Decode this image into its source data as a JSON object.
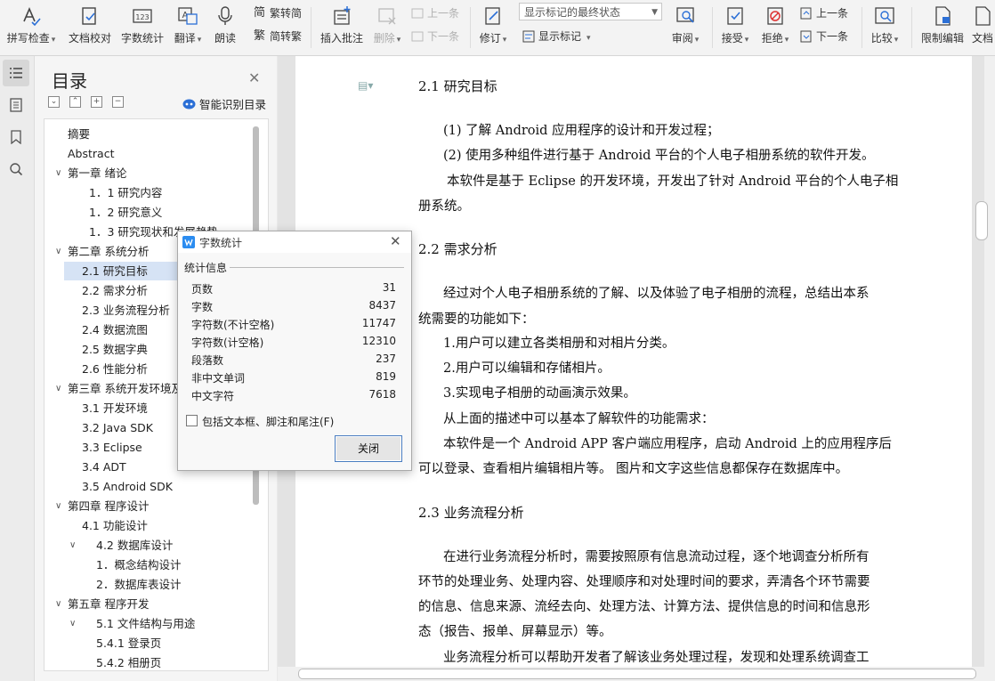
{
  "toolbar": {
    "items": [
      {
        "label": "拼写检查",
        "icon": "spellcheck-icon"
      },
      {
        "label": "文档校对",
        "icon": "proofread-icon"
      },
      {
        "label": "字数统计",
        "icon": "word-count-icon"
      },
      {
        "label": "翻译",
        "icon": "translate-icon"
      },
      {
        "label": "朗读",
        "icon": "read-aloud-icon"
      },
      {
        "label": "繁转简",
        "icon": "traditional-to-simple-icon"
      },
      {
        "label": "简转繁",
        "icon": "simple-to-traditional-icon"
      },
      {
        "label": "插入批注",
        "icon": "insert-comment-icon"
      },
      {
        "label": "删除",
        "icon": "delete-comment-icon"
      },
      {
        "label": "上一条",
        "icon": "prev-comment-icon"
      },
      {
        "label": "下一条",
        "icon": "next-comment-icon"
      },
      {
        "label": "修订",
        "icon": "track-changes-icon"
      },
      {
        "label": "显示标记",
        "icon": "show-markup-icon"
      },
      {
        "label": "审阅",
        "icon": "review-icon"
      },
      {
        "label": "接受",
        "icon": "accept-icon"
      },
      {
        "label": "拒绝",
        "icon": "reject-icon"
      },
      {
        "label": "上一条",
        "icon": "prev-change-icon"
      },
      {
        "label": "下一条",
        "icon": "next-change-icon"
      },
      {
        "label": "比较",
        "icon": "compare-icon"
      },
      {
        "label": "限制编辑",
        "icon": "restrict-editing-icon"
      },
      {
        "label": "文档",
        "icon": "document-icon"
      }
    ],
    "markup_mode": "显示标记的最终状态"
  },
  "toc": {
    "title": "目录",
    "smart_label": "智能识别目录",
    "items": [
      {
        "text": "摘要",
        "indent": 0,
        "chevron": false
      },
      {
        "text": "Abstract",
        "indent": 0,
        "chevron": false
      },
      {
        "text": "第一章 绪论",
        "indent": 0,
        "chevron": true
      },
      {
        "text": "1．1  研究内容",
        "indent": 2,
        "chevron": false
      },
      {
        "text": "1．2  研究意义",
        "indent": 2,
        "chevron": false
      },
      {
        "text": "1．3 研究现状和发展趋势",
        "indent": 2,
        "chevron": false
      },
      {
        "text": "第二章   系统分析",
        "indent": 0,
        "chevron": true
      },
      {
        "text": "2.1  研究目标",
        "indent": 1,
        "chevron": false,
        "selected": true
      },
      {
        "text": "2.2  需求分析",
        "indent": 1,
        "chevron": false
      },
      {
        "text": "2.3 业务流程分析",
        "indent": 1,
        "chevron": false
      },
      {
        "text": "2.4 数据流图",
        "indent": 1,
        "chevron": false
      },
      {
        "text": "2.5 数据字典",
        "indent": 1,
        "chevron": false
      },
      {
        "text": "2.6 性能分析",
        "indent": 1,
        "chevron": false
      },
      {
        "text": "第三章  系统开发环境及",
        "indent": 0,
        "chevron": true
      },
      {
        "text": "3.1 开发环境",
        "indent": 1,
        "chevron": false
      },
      {
        "text": "3.2 Java SDK",
        "indent": 1,
        "chevron": false
      },
      {
        "text": "3.3 Eclipse",
        "indent": 1,
        "chevron": false
      },
      {
        "text": "3.4 ADT",
        "indent": 1,
        "chevron": false
      },
      {
        "text": "3.5 Android SDK",
        "indent": 1,
        "chevron": false
      },
      {
        "text": "第四章  程序设计",
        "indent": 0,
        "chevron": true
      },
      {
        "text": "4.1    功能设计",
        "indent": 1,
        "chevron": false
      },
      {
        "text": "4.2    数据库设计",
        "indent": 1,
        "chevron": true
      },
      {
        "text": "1．概念结构设计",
        "indent": 3,
        "chevron": false
      },
      {
        "text": "2．数据库表设计",
        "indent": 3,
        "chevron": false
      },
      {
        "text": "第五章  程序开发",
        "indent": 0,
        "chevron": true
      },
      {
        "text": "5.1    文件结构与用途",
        "indent": 1,
        "chevron": true
      },
      {
        "text": "5.4.1 登录页",
        "indent": 3,
        "chevron": false
      },
      {
        "text": "5.4.2 相册页",
        "indent": 3,
        "chevron": false
      }
    ]
  },
  "document": {
    "h1": "2.1  研究目标",
    "p1": "(1)  了解 Android 应用程序的设计和开发过程；",
    "p2": "(2)  使用多种组件进行基于 Android  平台的个人电子相册系统的软件开发。",
    "p3a": "本软件是基于 Eclipse 的开发环境，开发出了针对 Android 平台的个人电子相",
    "p3b": "册系统。",
    "h2": "2.2  需求分析",
    "p4a": "经过对个人电子相册系统的了解、以及体验了电子相册的流程，总结出本系",
    "p4b": "统需要的功能如下：",
    "l1": "1.用户可以建立各类相册和对相片分类。",
    "l2": "2.用户可以编辑和存储相片。",
    "l3": "3.实现电子相册的动画演示效果。",
    "p5": "从上面的描述中可以基本了解软件的功能需求：",
    "p6a": "本软件是一个 Android APP 客户端应用程序，启动 Android 上的应用程序后",
    "p6b": "可以登录、查看相片编辑相片等。  图片和文字这些信息都保存在数据库中。",
    "h3": "2.3 业务流程分析",
    "p7a": "在进行业务流程分析时，需要按照原有信息流动过程，逐个地调查分析所有",
    "p7b": "环节的处理业务、处理内容、处理顺序和对处理时间的要求，弄清各个环节需要",
    "p7c": "的信息、信息来源、流经去向、处理方法、计算方法、提供信息的时间和信息形",
    "p7d": "态（报告、报单、屏幕显示）等。",
    "p8": "业务流程分析可以帮助开发者了解该业务处理过程，发现和处理系统调查工"
  },
  "dialog": {
    "title": "字数统计",
    "section": "统计信息",
    "stats": [
      {
        "label": "页数",
        "value": "31"
      },
      {
        "label": "字数",
        "value": "8437"
      },
      {
        "label": "字符数(不计空格)",
        "value": "11747"
      },
      {
        "label": "字符数(计空格)",
        "value": "12310"
      },
      {
        "label": "段落数",
        "value": "237"
      },
      {
        "label": "非中文单词",
        "value": "819"
      },
      {
        "label": "中文字符",
        "value": "7618"
      }
    ],
    "checkbox_label": "包括文本框、脚注和尾注(F)",
    "close_label": "关闭"
  },
  "colors": {
    "accent": "#2b6fd6",
    "selected": "#d6e3f5"
  }
}
